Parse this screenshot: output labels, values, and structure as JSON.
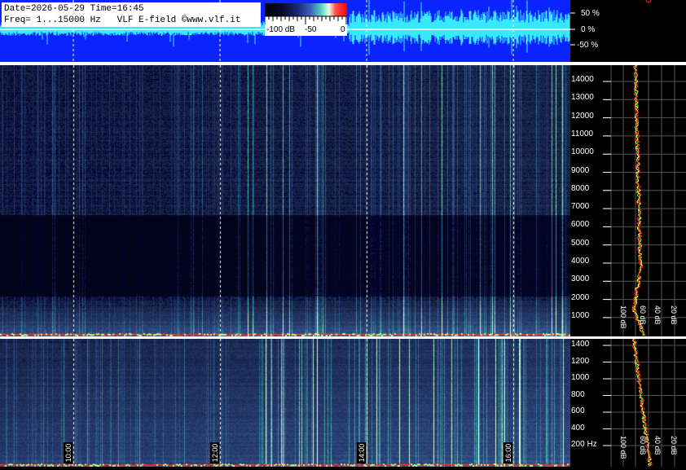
{
  "info": {
    "line1": "Date=2026-05-29 Time=16:45",
    "line2": "Freq= 1...15000 Hz   VLF E-field ©www.vlf.it"
  },
  "colorbar": {
    "labels": [
      "-100 dB",
      "-50",
      "0"
    ]
  },
  "amplitude_axis": {
    "labels": [
      "50 %",
      "0 %",
      "-50 %"
    ]
  },
  "freq_axis_wide": {
    "labels": [
      "14000",
      "13000",
      "12000",
      "11000",
      "10000",
      "9000",
      "8000",
      "7000",
      "6000",
      "5000",
      "4000",
      "3000",
      "2000",
      "1000"
    ]
  },
  "freq_axis_narrow": {
    "labels": [
      "1400",
      "1200",
      "1000",
      "800",
      "600",
      "400",
      "200 Hz"
    ]
  },
  "spectrum_db_labels_wide": [
    "100 dB",
    "60 dB",
    "40 dB",
    "20 dB"
  ],
  "spectrum_db_labels_narrow": [
    "100 dB",
    "60 dB",
    "40 dB",
    "20 dB"
  ],
  "time_labels": [
    "10:00",
    "12:00",
    "14:00",
    "16:00"
  ],
  "colors": {
    "waveform_bg": "#0a23ff",
    "waveform_trace": "#38e8ff",
    "spectrum_red": "#ff2020",
    "spectrum_yellow": "#ffff40",
    "spectrum_green": "#40ff40"
  }
}
